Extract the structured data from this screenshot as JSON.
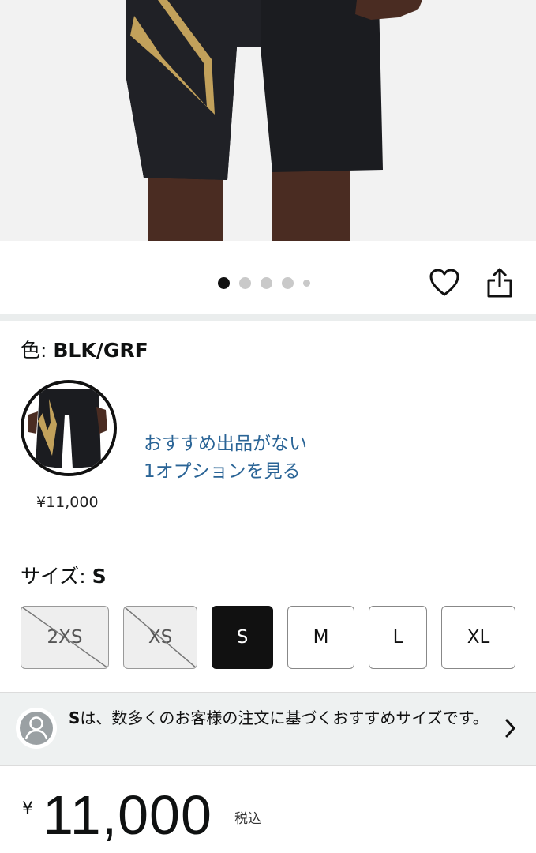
{
  "product": {
    "image_alt": "compression shorts",
    "carousel": {
      "total": 5,
      "active_index": 0
    }
  },
  "actions": {
    "wishlist_icon": "heart-icon",
    "share_icon": "share-icon"
  },
  "color": {
    "label": "色: ",
    "value": "BLK/GRF",
    "swatch_price": "¥11,000",
    "offer_link_line1": "おすすめ出品がない",
    "offer_link_line2": "1オプションを見る"
  },
  "size": {
    "label": "サイズ: ",
    "value": "S",
    "options": [
      {
        "label": "2XS",
        "available": false,
        "selected": false
      },
      {
        "label": "XS",
        "available": false,
        "selected": false
      },
      {
        "label": "S",
        "available": true,
        "selected": true
      },
      {
        "label": "M",
        "available": true,
        "selected": false
      },
      {
        "label": "L",
        "available": true,
        "selected": false
      },
      {
        "label": "XL",
        "available": true,
        "selected": false
      }
    ]
  },
  "recommendation": {
    "bold": "S",
    "text": "は、数多くのお客様の注文に基づくおすすめサイズです。",
    "avatar_icon": "user-avatar-icon",
    "chevron_icon": "chevron-right-icon"
  },
  "price": {
    "currency": "¥",
    "amount": "11,000",
    "tax_note": "税込"
  },
  "colors": {
    "link": "#2a6496",
    "selected_bg": "#111111",
    "banner_bg": "#eef1f1"
  }
}
